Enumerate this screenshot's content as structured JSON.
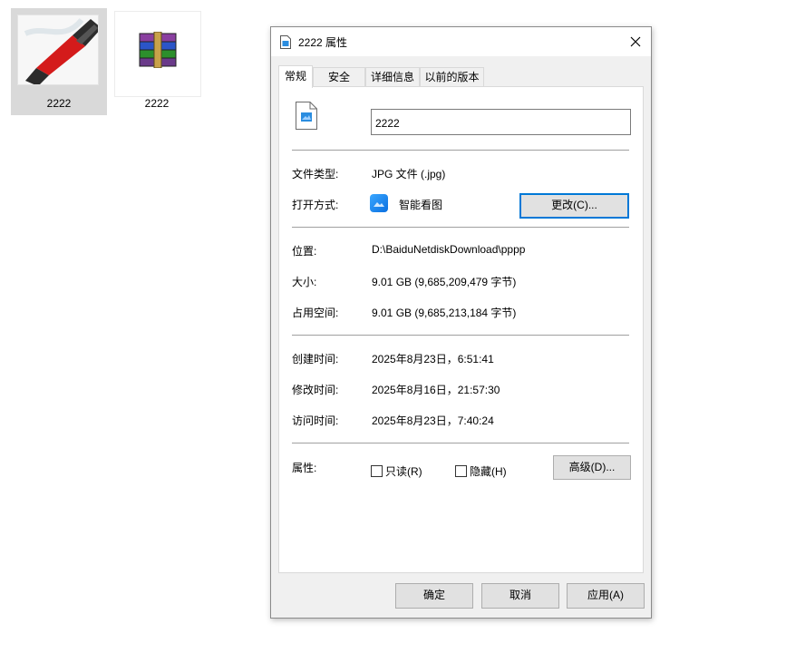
{
  "desktop": {
    "files": [
      {
        "name": "2222",
        "type": "jpg image",
        "selected": true
      },
      {
        "name": "2222",
        "type": "rar archive",
        "selected": false
      }
    ]
  },
  "dialog": {
    "title": "2222 属性",
    "close_icon": "close-icon",
    "tabs": [
      {
        "label": "常规",
        "active": true
      },
      {
        "label": "安全",
        "active": false
      },
      {
        "label": "详细信息",
        "active": false
      },
      {
        "label": "以前的版本",
        "active": false
      }
    ],
    "general": {
      "file_name": "2222",
      "file_type_label": "文件类型:",
      "file_type_value": "JPG 文件 (.jpg)",
      "open_with_label": "打开方式:",
      "open_with_value": "智能看图",
      "change_button": "更改(C)...",
      "location_label": "位置:",
      "location_value": "D:\\BaiduNetdiskDownload\\pppp",
      "size_label": "大小:",
      "size_value": "9.01 GB (9,685,209,479 字节)",
      "size_on_disk_label": "占用空间:",
      "size_on_disk_value": "9.01 GB (9,685,213,184 字节)",
      "created_label": "创建时间:",
      "created_value": "2025年8月23日，6:51:41",
      "modified_label": "修改时间:",
      "modified_value": "2025年8月16日，21:57:30",
      "accessed_label": "访问时间:",
      "accessed_value": "2025年8月23日，7:40:24",
      "attributes_label": "属性:",
      "readonly_label": "只读(R)",
      "readonly_checked": false,
      "hidden_label": "隐藏(H)",
      "hidden_checked": false,
      "advanced_button": "高级(D)..."
    },
    "footer": {
      "ok": "确定",
      "cancel": "取消",
      "apply": "应用(A)"
    }
  },
  "colors": {
    "focus_border": "#0078d7",
    "dialog_bg": "#f0f0f0",
    "button_bg": "#e1e1e1",
    "selection_bg": "#d9d9d9"
  }
}
